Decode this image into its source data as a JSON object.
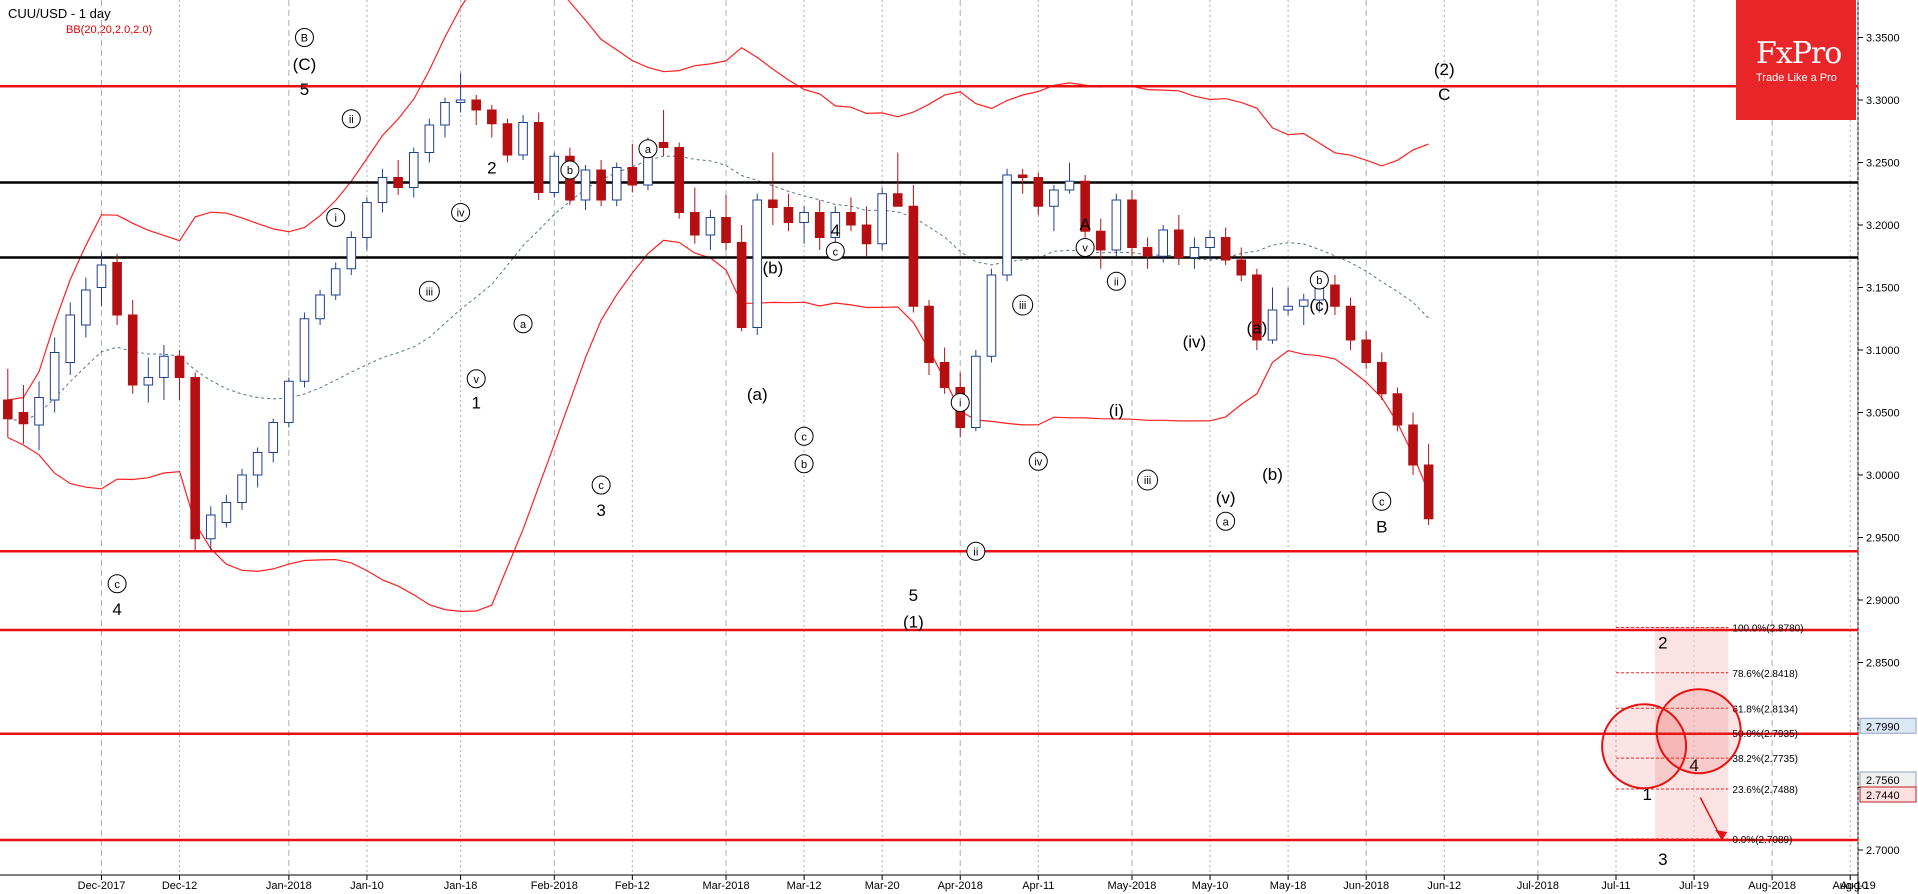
{
  "header": {
    "symbol_title": "CUU/USD - 1 day",
    "indicator": "BB(20,20,2.0,2.0)"
  },
  "logo": {
    "brand": "FxPro",
    "tagline": "Trade Like a Pro"
  },
  "colors": {
    "bull": "#1f3f8f",
    "bear": "#b50f12",
    "band": "#ff2020",
    "hline_red": "#e81010",
    "hline_black": "#000000"
  },
  "chart_data": {
    "type": "candlestick",
    "ylim": [
      2.68,
      3.38
    ],
    "y_ticks": [
      "3.3500",
      "3.3000",
      "3.2500",
      "3.2000",
      "3.1500",
      "3.1000",
      "3.0500",
      "3.0000",
      "2.9500",
      "2.9000",
      "2.8500",
      "2.8000",
      "2.7500",
      "2.7000"
    ],
    "x_ticks": [
      "Dec-2017",
      "Dec-12",
      "Jan-2018",
      "Jan-10",
      "Jan-18",
      "Feb-2018",
      "Feb-12",
      "Mar-2018",
      "Mar-12",
      "Mar-20",
      "Apr-2018",
      "Apr-11",
      "May-2018",
      "May-10",
      "May-18",
      "Jun-2018",
      "Jun-12",
      "Jul-2018",
      "Jul-11",
      "Jul-19",
      "Aug-2018",
      "Aug-10",
      "Aug-19"
    ],
    "price_badges": [
      {
        "label": "2.7990",
        "value": 2.799,
        "style": "blue"
      },
      {
        "label": "2.7560",
        "value": 2.756,
        "style": "light"
      },
      {
        "label": "2.7440",
        "value": 2.744,
        "style": "red"
      }
    ],
    "horizontal_lines": [
      {
        "value": 3.311,
        "color": "red"
      },
      {
        "value": 3.234,
        "color": "black"
      },
      {
        "value": 3.174,
        "color": "black"
      },
      {
        "value": 2.939,
        "color": "red"
      },
      {
        "value": 2.876,
        "color": "red"
      },
      {
        "value": 2.793,
        "color": "red"
      },
      {
        "value": 2.708,
        "color": "red"
      }
    ],
    "fibonacci": [
      {
        "label": "100.0%(2.8780)",
        "value": 2.878
      },
      {
        "label": "78.6%(2.8418)",
        "value": 2.8418
      },
      {
        "label": "61.8%(2.8134)",
        "value": 2.8134
      },
      {
        "label": "50.0%(2.7935)",
        "value": 2.7935
      },
      {
        "label": "38.2%(2.7735)",
        "value": 2.7735
      },
      {
        "label": "23.6%(2.7488)",
        "value": 2.7488
      },
      {
        "label": "0.0%(2.7089)",
        "value": 2.7089
      }
    ],
    "wave_labels": [
      {
        "text": "B",
        "circle": true,
        "x": 19,
        "y": 3.35
      },
      {
        "text": "(C)",
        "x": 19,
        "y": 3.329
      },
      {
        "text": "5",
        "x": 19,
        "y": 3.309
      },
      {
        "text": "ii",
        "circle": true,
        "x": 22,
        "y": 3.285
      },
      {
        "text": "i",
        "circle": true,
        "x": 21,
        "y": 3.206
      },
      {
        "text": "2",
        "x": 31,
        "y": 3.246
      },
      {
        "text": "iv",
        "circle": true,
        "x": 29,
        "y": 3.21
      },
      {
        "text": "b",
        "circle": true,
        "x": 36,
        "y": 3.244
      },
      {
        "text": "a",
        "circle": true,
        "x": 41,
        "y": 3.261
      },
      {
        "text": "iii",
        "circle": true,
        "x": 27,
        "y": 3.147
      },
      {
        "text": "a",
        "circle": true,
        "x": 33,
        "y": 3.121
      },
      {
        "text": "v",
        "circle": true,
        "x": 30,
        "y": 3.077
      },
      {
        "text": "1",
        "x": 30,
        "y": 3.058
      },
      {
        "text": "c",
        "circle": true,
        "x": 38,
        "y": 2.992
      },
      {
        "text": "3",
        "x": 38,
        "y": 2.972
      },
      {
        "text": "c",
        "circle": true,
        "x": 7,
        "y": 2.913
      },
      {
        "text": "4",
        "x": 7,
        "y": 2.893
      },
      {
        "text": "4",
        "x": 53,
        "y": 3.196
      },
      {
        "text": "c",
        "circle": true,
        "x": 53,
        "y": 3.179
      },
      {
        "text": "(b)",
        "x": 49,
        "y": 3.166
      },
      {
        "text": "(a)",
        "x": 48,
        "y": 3.065
      },
      {
        "text": "c",
        "circle": true,
        "x": 51,
        "y": 3.031
      },
      {
        "text": "b",
        "circle": true,
        "x": 51,
        "y": 3.009
      },
      {
        "text": "i",
        "circle": true,
        "x": 61,
        "y": 3.058
      },
      {
        "text": "ii",
        "circle": true,
        "x": 62,
        "y": 2.939
      },
      {
        "text": "5",
        "x": 58,
        "y": 2.904
      },
      {
        "text": "(1)",
        "x": 58,
        "y": 2.883
      },
      {
        "text": "A",
        "x": 69,
        "y": 3.201
      },
      {
        "text": "v",
        "circle": true,
        "x": 69,
        "y": 3.182
      },
      {
        "text": "iii",
        "circle": true,
        "x": 65,
        "y": 3.136
      },
      {
        "text": "ii",
        "circle": true,
        "x": 71,
        "y": 3.155
      },
      {
        "text": "iv",
        "circle": true,
        "x": 66,
        "y": 3.011
      },
      {
        "text": "(i)",
        "x": 71,
        "y": 3.052
      },
      {
        "text": "iii",
        "circle": true,
        "x": 73,
        "y": 2.996
      },
      {
        "text": "(iv)",
        "x": 76,
        "y": 3.107
      },
      {
        "text": "(v)",
        "x": 78,
        "y": 2.982
      },
      {
        "text": "a",
        "circle": true,
        "x": 78,
        "y": 2.963
      },
      {
        "text": "(a)",
        "x": 80,
        "y": 3.118
      },
      {
        "text": "(b)",
        "x": 81,
        "y": 3.001
      },
      {
        "text": "b",
        "circle": true,
        "x": 84,
        "y": 3.156
      },
      {
        "text": "(c)",
        "x": 84,
        "y": 3.136
      },
      {
        "text": "c",
        "circle": true,
        "x": 88,
        "y": 2.979
      },
      {
        "text": "B",
        "x": 88,
        "y": 2.959
      },
      {
        "text": "(2)",
        "x": 92,
        "y": 3.325
      },
      {
        "text": "C",
        "x": 92,
        "y": 3.305
      },
      {
        "text": "2",
        "x": 106,
        "y": 2.866
      },
      {
        "text": "1",
        "x": 105,
        "y": 2.745
      },
      {
        "text": "4",
        "x": 108,
        "y": 2.768
      },
      {
        "text": "3",
        "x": 106,
        "y": 2.693
      }
    ],
    "circles": [
      {
        "x": 104.8,
        "y": 2.783,
        "r": 30
      },
      {
        "x": 108.3,
        "y": 2.795,
        "r": 30
      }
    ],
    "arrow": {
      "x1": 108.4,
      "y1": 2.742,
      "x2": 109.8,
      "y2": 2.708
    },
    "candles": [
      [
        3.06,
        3.085,
        3.03,
        3.045
      ],
      [
        3.05,
        3.072,
        3.025,
        3.041
      ],
      [
        3.04,
        3.075,
        3.02,
        3.062
      ],
      [
        3.06,
        3.11,
        3.05,
        3.098
      ],
      [
        3.09,
        3.138,
        3.08,
        3.128
      ],
      [
        3.12,
        3.158,
        3.11,
        3.148
      ],
      [
        3.15,
        3.178,
        3.135,
        3.168
      ],
      [
        3.17,
        3.177,
        3.12,
        3.128
      ],
      [
        3.128,
        3.14,
        3.065,
        3.072
      ],
      [
        3.072,
        3.094,
        3.058,
        3.078
      ],
      [
        3.078,
        3.104,
        3.06,
        3.095
      ],
      [
        3.095,
        3.1,
        3.06,
        3.078
      ],
      [
        3.078,
        3.082,
        2.94,
        2.949
      ],
      [
        2.949,
        2.975,
        2.94,
        2.968
      ],
      [
        2.962,
        2.984,
        2.958,
        2.978
      ],
      [
        2.978,
        3.005,
        2.972,
        3.0
      ],
      [
        3.0,
        3.022,
        2.99,
        3.018
      ],
      [
        3.018,
        3.045,
        3.01,
        3.042
      ],
      [
        3.042,
        3.078,
        3.038,
        3.075
      ],
      [
        3.075,
        3.13,
        3.07,
        3.125
      ],
      [
        3.125,
        3.148,
        3.12,
        3.144
      ],
      [
        3.144,
        3.17,
        3.14,
        3.165
      ],
      [
        3.165,
        3.195,
        3.16,
        3.19
      ],
      [
        3.19,
        3.222,
        3.18,
        3.218
      ],
      [
        3.218,
        3.245,
        3.21,
        3.238
      ],
      [
        3.238,
        3.252,
        3.224,
        3.23
      ],
      [
        3.23,
        3.262,
        3.222,
        3.258
      ],
      [
        3.258,
        3.285,
        3.25,
        3.28
      ],
      [
        3.28,
        3.302,
        3.27,
        3.298
      ],
      [
        3.298,
        3.322,
        3.29,
        3.3
      ],
      [
        3.3,
        3.304,
        3.28,
        3.292
      ],
      [
        3.292,
        3.296,
        3.27,
        3.281
      ],
      [
        3.281,
        3.285,
        3.25,
        3.256
      ],
      [
        3.256,
        3.288,
        3.252,
        3.282
      ],
      [
        3.282,
        3.29,
        3.22,
        3.226
      ],
      [
        3.226,
        3.258,
        3.222,
        3.255
      ],
      [
        3.255,
        3.262,
        3.216,
        3.22
      ],
      [
        3.22,
        3.248,
        3.212,
        3.244
      ],
      [
        3.244,
        3.252,
        3.215,
        3.22
      ],
      [
        3.22,
        3.25,
        3.215,
        3.246
      ],
      [
        3.246,
        3.265,
        3.226,
        3.232
      ],
      [
        3.232,
        3.27,
        3.228,
        3.266
      ],
      [
        3.266,
        3.292,
        3.255,
        3.262
      ],
      [
        3.262,
        3.266,
        3.205,
        3.21
      ],
      [
        3.21,
        3.23,
        3.185,
        3.192
      ],
      [
        3.192,
        3.212,
        3.18,
        3.206
      ],
      [
        3.206,
        3.224,
        3.18,
        3.186
      ],
      [
        3.186,
        3.2,
        3.115,
        3.118
      ],
      [
        3.118,
        3.225,
        3.112,
        3.22
      ],
      [
        3.22,
        3.258,
        3.2,
        3.214
      ],
      [
        3.214,
        3.225,
        3.195,
        3.202
      ],
      [
        3.202,
        3.215,
        3.185,
        3.21
      ],
      [
        3.21,
        3.22,
        3.18,
        3.19
      ],
      [
        3.19,
        3.215,
        3.182,
        3.21
      ],
      [
        3.21,
        3.222,
        3.195,
        3.2
      ],
      [
        3.2,
        3.215,
        3.175,
        3.185
      ],
      [
        3.185,
        3.23,
        3.18,
        3.225
      ],
      [
        3.225,
        3.258,
        3.218,
        3.215
      ],
      [
        3.215,
        3.232,
        3.13,
        3.135
      ],
      [
        3.135,
        3.14,
        3.08,
        3.09
      ],
      [
        3.09,
        3.102,
        3.065,
        3.07
      ],
      [
        3.07,
        3.082,
        3.03,
        3.038
      ],
      [
        3.038,
        3.1,
        3.035,
        3.095
      ],
      [
        3.095,
        3.165,
        3.09,
        3.16
      ],
      [
        3.16,
        3.245,
        3.155,
        3.24
      ],
      [
        3.24,
        3.245,
        3.225,
        3.238
      ],
      [
        3.238,
        3.242,
        3.208,
        3.215
      ],
      [
        3.215,
        3.232,
        3.195,
        3.228
      ],
      [
        3.228,
        3.25,
        3.225,
        3.235
      ],
      [
        3.235,
        3.24,
        3.19,
        3.195
      ],
      [
        3.195,
        3.205,
        3.165,
        3.18
      ],
      [
        3.18,
        3.225,
        3.175,
        3.22
      ],
      [
        3.22,
        3.228,
        3.175,
        3.182
      ],
      [
        3.182,
        3.19,
        3.165,
        3.175
      ],
      [
        3.175,
        3.2,
        3.17,
        3.196
      ],
      [
        3.196,
        3.208,
        3.168,
        3.174
      ],
      [
        3.174,
        3.19,
        3.165,
        3.182
      ],
      [
        3.182,
        3.196,
        3.172,
        3.19
      ],
      [
        3.19,
        3.198,
        3.168,
        3.172
      ],
      [
        3.172,
        3.182,
        3.155,
        3.16
      ],
      [
        3.16,
        3.165,
        3.1,
        3.108
      ],
      [
        3.108,
        3.15,
        3.105,
        3.132
      ],
      [
        3.132,
        3.15,
        3.128,
        3.135
      ],
      [
        3.135,
        3.145,
        3.12,
        3.14
      ],
      [
        3.14,
        3.155,
        3.13,
        3.152
      ],
      [
        3.152,
        3.16,
        3.128,
        3.135
      ],
      [
        3.135,
        3.142,
        3.1,
        3.108
      ],
      [
        3.108,
        3.115,
        3.085,
        3.09
      ],
      [
        3.09,
        3.098,
        3.06,
        3.065
      ],
      [
        3.065,
        3.07,
        3.035,
        3.04
      ],
      [
        3.04,
        3.05,
        3.0,
        3.008
      ],
      [
        3.008,
        3.025,
        2.96,
        2.965
      ]
    ],
    "xmax": 119
  }
}
